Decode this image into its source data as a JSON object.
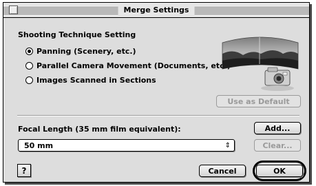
{
  "window": {
    "title": "Merge Settings"
  },
  "technique": {
    "label": "Shooting Technique Setting",
    "options": [
      {
        "label": "Panning (Scenery, etc.)",
        "selected": true
      },
      {
        "label": "Parallel Camera Movement (Documents, etc.)",
        "selected": false
      },
      {
        "label": "Images Scanned in Sections",
        "selected": false
      }
    ]
  },
  "buttons": {
    "use_default": "Use as Default",
    "add": "Add...",
    "clear": "Clear...",
    "cancel": "Cancel",
    "ok": "OK",
    "help": "?"
  },
  "focal": {
    "label": "Focal Length (35 mm film equivalent):",
    "selected": "50 mm",
    "arrows": "⇕"
  },
  "icons": {
    "close": "close-box-icon",
    "preview": "panorama-camera-illustration",
    "select": "up-down-arrows-icon",
    "help": "help-icon"
  }
}
